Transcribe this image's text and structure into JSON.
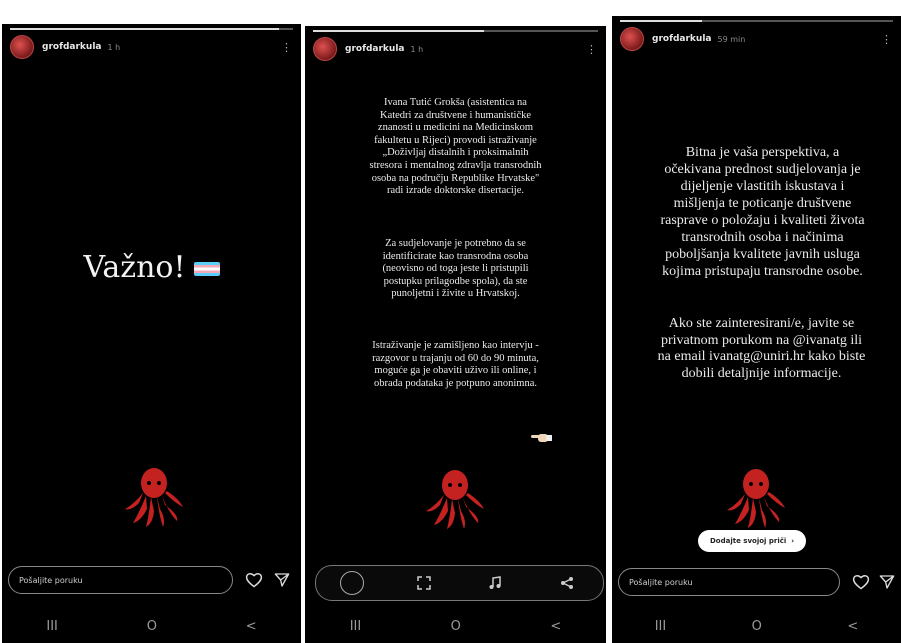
{
  "stories": [
    {
      "username": "grofdarkula",
      "time": "1 h",
      "progress": 0.95,
      "title": "Važno!",
      "reply_placeholder": "Pošaljite poruku"
    },
    {
      "username": "grofdarkula",
      "time": "1 h",
      "progress": 0.6,
      "paragraphs": [
        "Ivana Tutić Grokša (asistentica na\nKatedri za društvene i humanističke\nznanosti u medicini na Medicinskom\nfakultetu u Rijeci) provodi istraživanje\n„Doživljaj distalnih i proksimalnih\nstresora i mentalnog zdravlja transrodnih\nosoba na području Republike Hrvatske\"\nradi izrade doktorske disertacije.",
        "Za sudjelovanje je potrebno da se\nidentificirate kao transrodna osoba\n(neovisno od toga jeste li pristupili\npostupku prilagodbe spola), da ste\npunoljetni i živite u Hrvatskoj.",
        "Istraživanje je zamišljeno kao intervju -\nrazgovor u trajanju od 60 do 90 minuta,\nmoguće ga je obaviti uživo ili online, i\nobrada podataka je potpuno anonimna."
      ]
    },
    {
      "username": "grofdarkula",
      "time": "59 min",
      "progress": 0.3,
      "paragraphs": [
        "Bitna je vaša perspektiva, a\nočekivana prednost sudjelovanja je\ndijeljenje vlastitih iskustava i\nmišljenja te poticanje društvene\nrasprave o položaju i kvaliteti života\ntransrodnih osoba i načinima\npoboljšanja kvalitete javnih usluga\nkojima pristupaju transrodne osobe.",
        "Ako ste zainteresirani/e, javite se\nprivatnom porukom na @ivanatg ili\nna email ivanatg@uniri.hr kako biste\ndobili detaljnije informacije."
      ],
      "add_story_label": "Dodajte svojoj priči",
      "reply_placeholder": "Pošaljite poruku"
    }
  ],
  "icons": {
    "heart": "heart-icon",
    "send": "send-icon",
    "menu": "more-options-icon",
    "octopus": "octopus-sticker",
    "flag": "trans-flag-icon",
    "pointing": "pointing-hand-icon"
  },
  "colors": {
    "background": "#000000",
    "octopus": "#c42121",
    "flag_blue": "#5bcefa",
    "flag_pink": "#f5a9b8"
  },
  "navbar": {
    "recents": "III",
    "home": "O",
    "back": "<"
  }
}
